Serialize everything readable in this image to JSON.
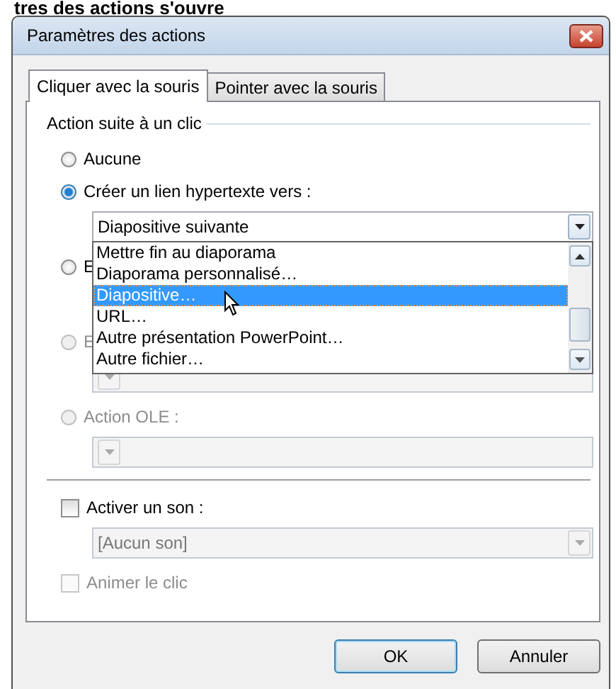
{
  "heading": "tres des actions s'ouvre",
  "window": {
    "title": "Paramètres des actions"
  },
  "tabs": [
    {
      "label": "Cliquer avec la souris",
      "selected": true
    },
    {
      "label": "Pointer avec la souris",
      "selected": false
    }
  ],
  "group": {
    "label": "Action suite à un clic"
  },
  "actions": [
    {
      "label": "Aucune",
      "selected": false,
      "disabled": false
    },
    {
      "label": "Créer un lien hypertexte vers :",
      "selected": true,
      "disabled": false,
      "dropdown": {
        "value": "Diapositive suivante",
        "disabled": false,
        "items": [
          {
            "label": "Mettre fin au diaporama",
            "selected": false
          },
          {
            "label": "Diaporama personnalisé…",
            "selected": false
          },
          {
            "label": "Diapositive…",
            "selected": true
          },
          {
            "label": "URL…",
            "selected": false
          },
          {
            "label": "Autre présentation PowerPoint…",
            "selected": false
          },
          {
            "label": "Autre fichier…",
            "selected": false
          }
        ]
      }
    },
    {
      "label": "E",
      "selected": false,
      "disabled": false
    },
    {
      "label": "E",
      "selected": false,
      "disabled": true,
      "dropdown": {
        "disabled": true
      }
    },
    {
      "label": "Action OLE :",
      "selected": false,
      "disabled": true,
      "dropdown": {
        "disabled": true
      }
    }
  ],
  "sound": {
    "label": "Activer un son :",
    "checked": false,
    "disabled": false,
    "dropdown": {
      "value": "[Aucun son]",
      "disabled": true
    }
  },
  "animate": {
    "label": "Animer le clic",
    "checked": false,
    "disabled": true
  },
  "buttons": [
    {
      "label": "OK",
      "default": true
    },
    {
      "label": "Annuler",
      "default": false
    }
  ]
}
